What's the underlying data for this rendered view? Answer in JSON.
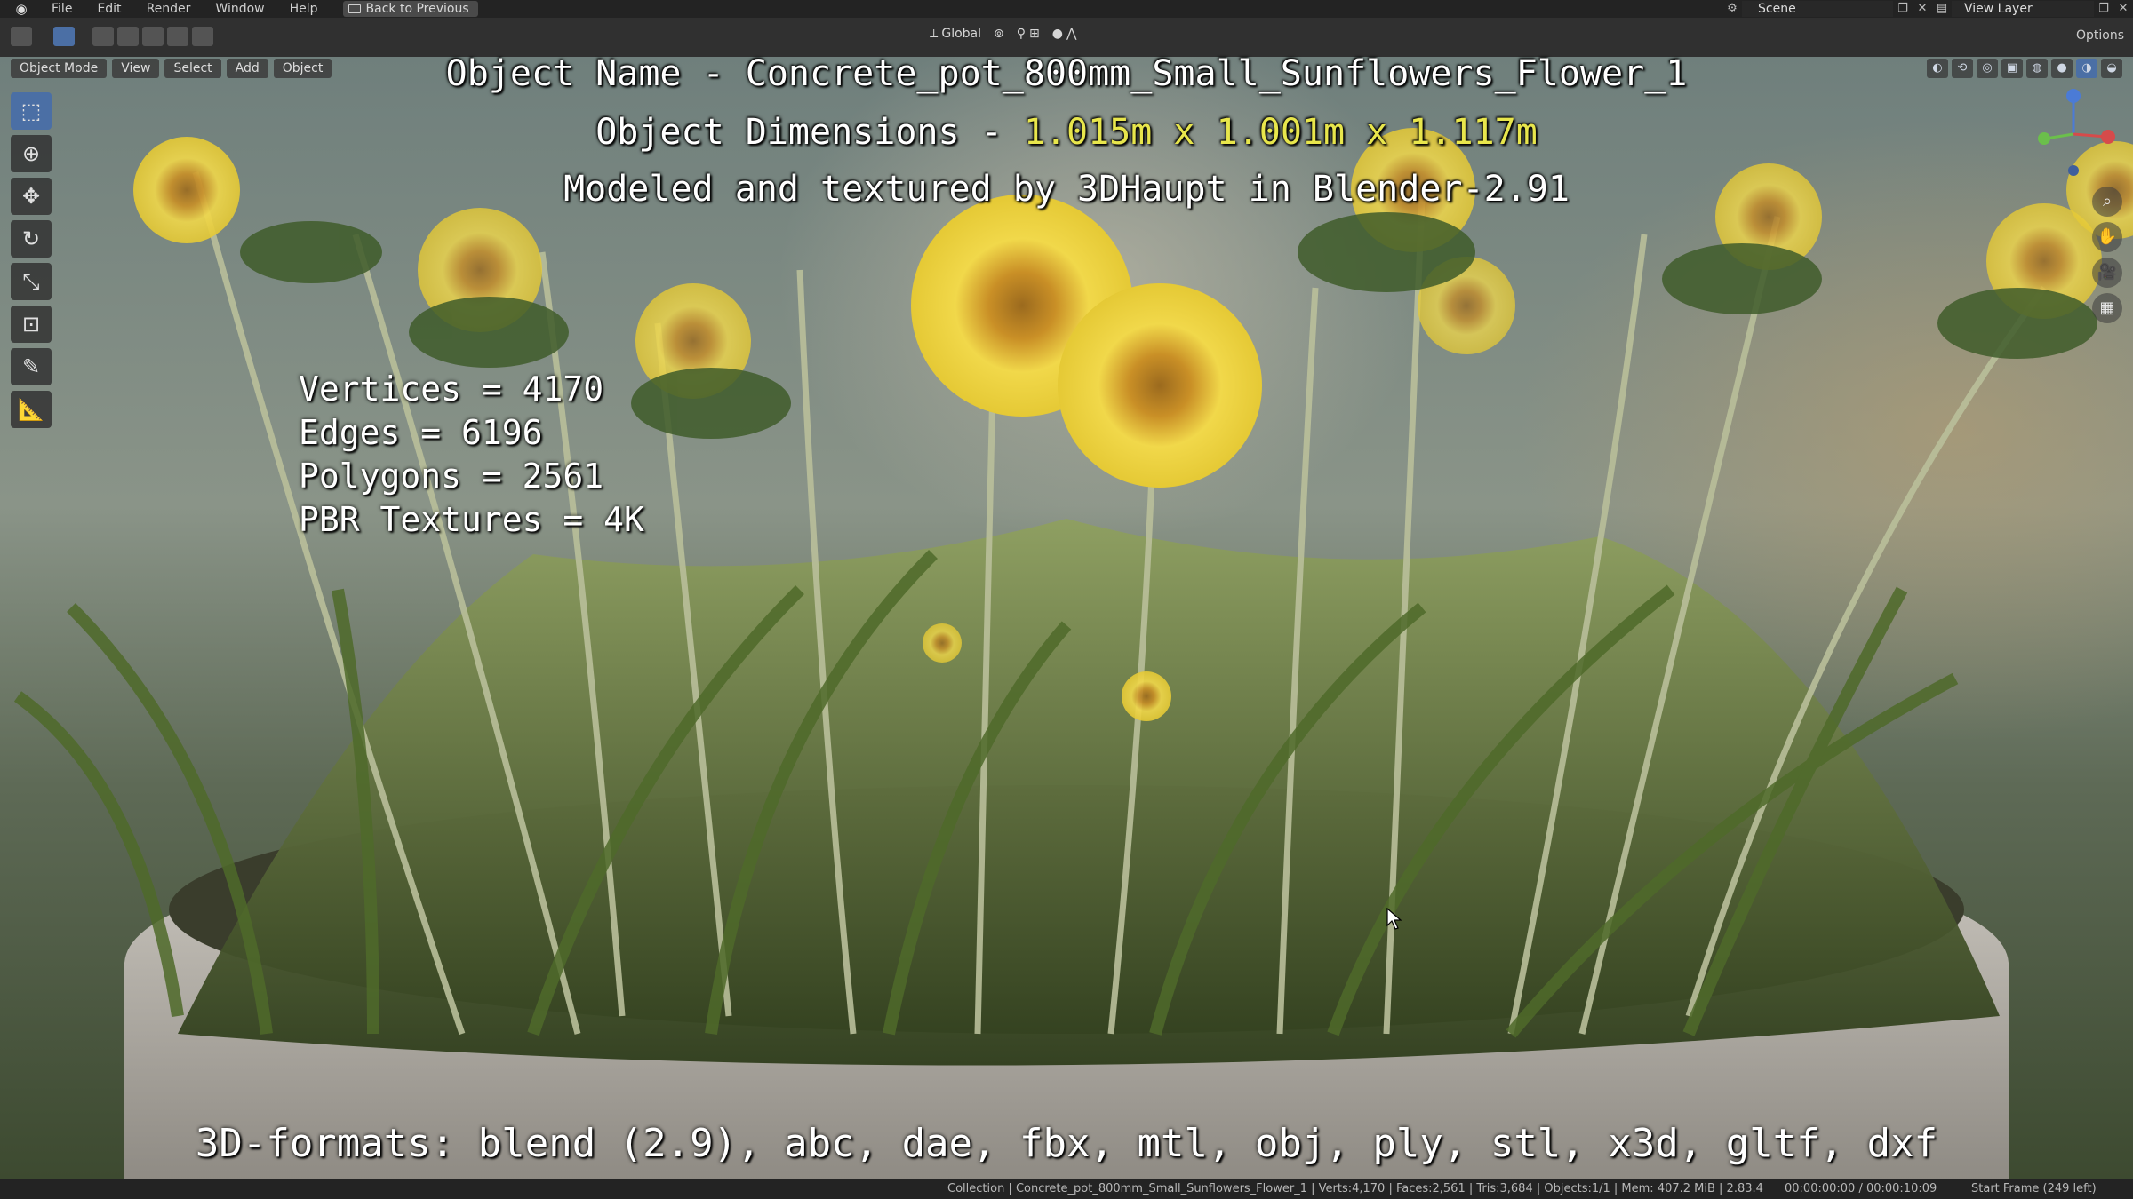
{
  "menubar": {
    "items": [
      "File",
      "Edit",
      "Render",
      "Window",
      "Help"
    ],
    "back_button": "Back to Previous",
    "scene_label": "Scene",
    "view_layer_label": "View Layer"
  },
  "toolbar": {
    "orientation": "Global",
    "options_label": "Options"
  },
  "viewport_header": {
    "mode": "Object Mode",
    "menus": [
      "View",
      "Select",
      "Add",
      "Object"
    ]
  },
  "overlay": {
    "title": "Object Name - Concrete_pot_800mm_Small_Sunflowers_Flower_1",
    "dimensions_label": "Object Dimensions - ",
    "dimensions_value": "1.015m x 1.001m x 1.117m",
    "modeled_by": "Modeled and textured by 3DHaupt in Blender-2.91",
    "stats": [
      "Vertices = 4170",
      "Edges = 6196",
      "Polygons = 2561",
      "PBR Textures = 4K"
    ],
    "formats": "3D-formats: blend (2.9), abc, dae, fbx, mtl, obj, ply, stl, x3d, gltf, dxf"
  },
  "statusbar": {
    "info": "Collection | Concrete_pot_800mm_Small_Sunflowers_Flower_1 | Verts:4,170 | Faces:2,561 | Tris:3,684 | Objects:1/1 | Mem: 407.2 MiB | 2.83.4",
    "timecode": "00:00:00:00 / 00:00:10:09",
    "start_frame": "Start Frame (249 left)"
  },
  "colors": {
    "accent_blue": "#4b6fa5",
    "highlight_yellow": "#e8e64c"
  }
}
